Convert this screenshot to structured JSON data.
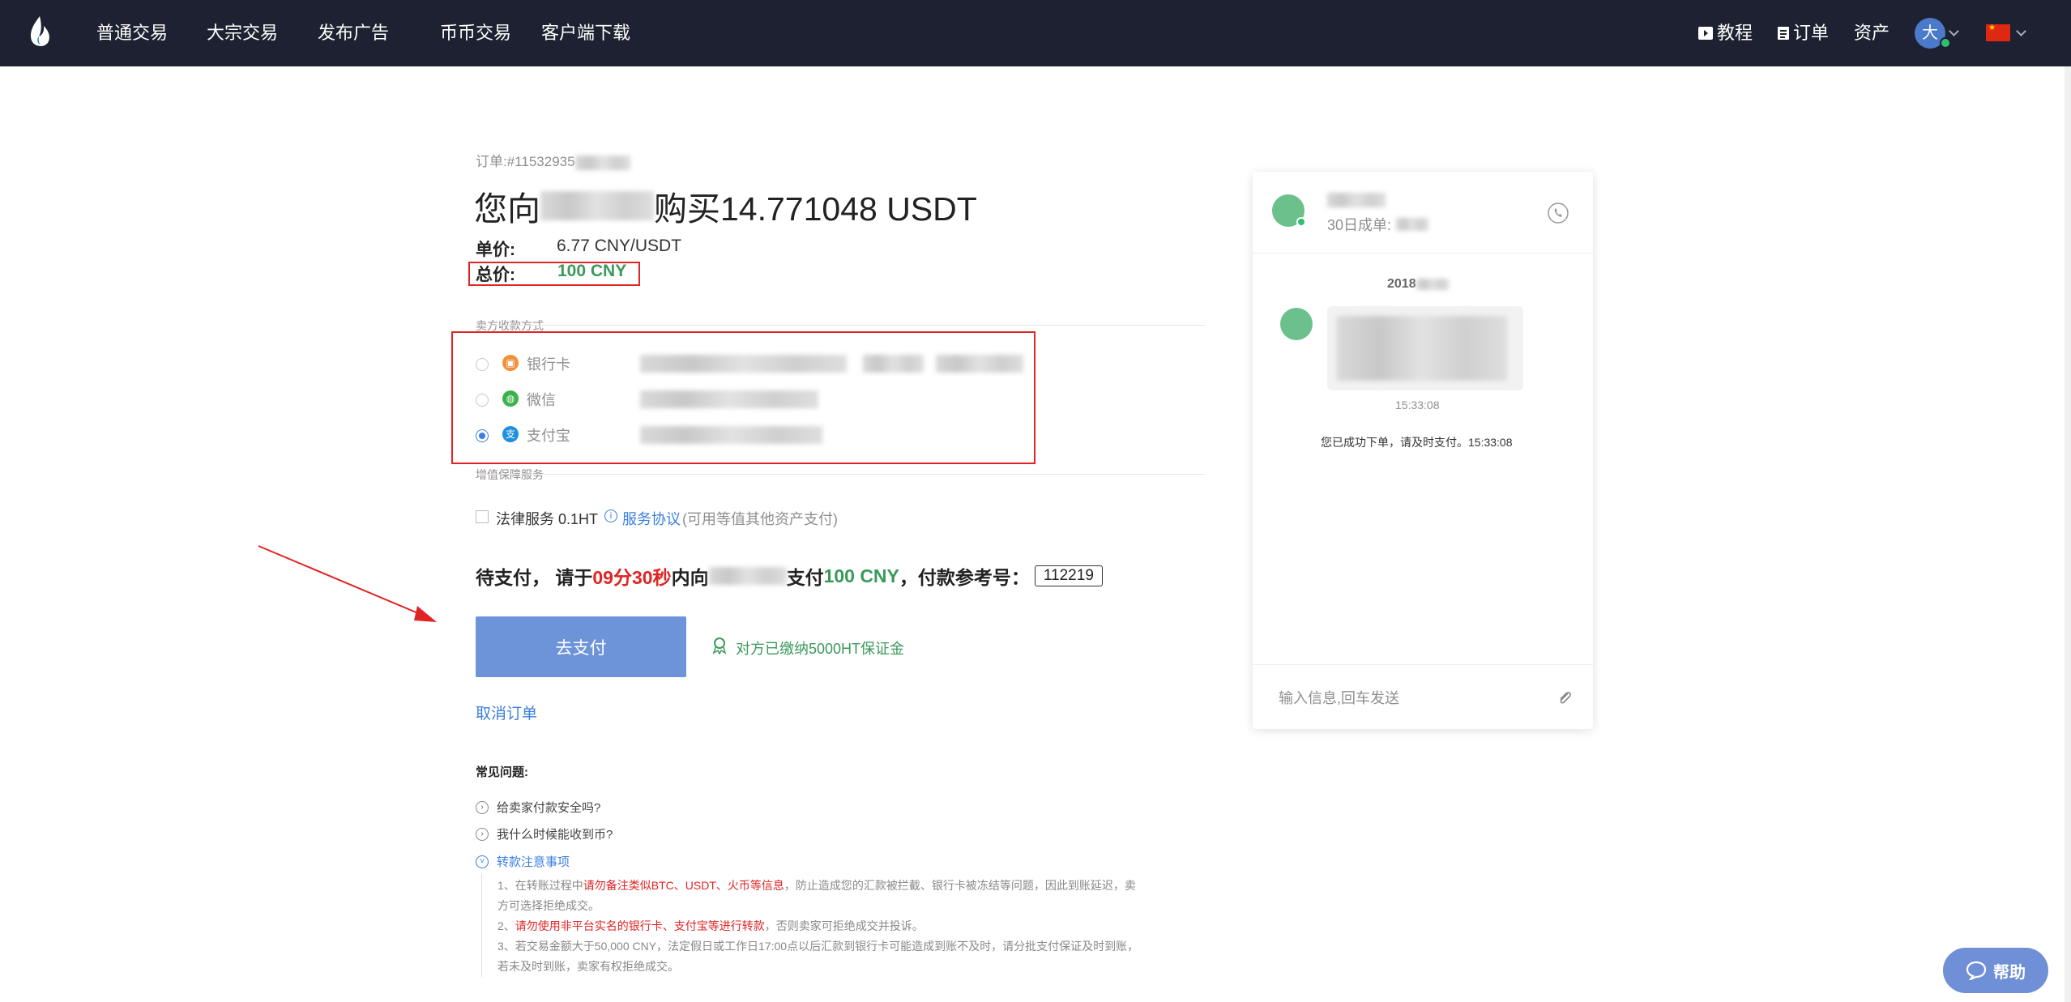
{
  "nav": {
    "items": [
      "普通交易",
      "大宗交易",
      "发布广告",
      "币币交易",
      "客户端下载"
    ],
    "tutorial": "教程",
    "orders": "订单",
    "assets": "资产",
    "avatar_text": "大"
  },
  "order": {
    "number_label": "订单:#11532935",
    "title_prefix": "您向",
    "title_suffix": "购买14.771048 USDT",
    "unit_price_label": "单价:",
    "unit_price": "6.77 CNY/USDT",
    "total_label": "总价:",
    "total": "100 CNY"
  },
  "payment": {
    "section_label": "卖方收款方式",
    "methods": [
      {
        "label": "银行卡",
        "icon": "bank-card-icon",
        "color": "#f0913a",
        "selected": false
      },
      {
        "label": "微信",
        "icon": "wechat-icon",
        "color": "#3cb34a",
        "selected": false
      },
      {
        "label": "支付宝",
        "icon": "alipay-icon",
        "color": "#1f8fe0",
        "selected": true
      }
    ]
  },
  "service": {
    "section_label": "增值保障服务",
    "legal_label": "法律服务 0.1HT",
    "agreement": "服务协议",
    "note": "(可用等值其他资产支付)"
  },
  "pending": {
    "prefix": "待支付，  请于",
    "countdown": "09分30秒",
    "mid": "内向",
    "pay": "支付",
    "amount": "100 CNY",
    "ref_label": "，付款参考号：",
    "ref": "112219"
  },
  "actions": {
    "pay_button": "去支付",
    "deposit_note": "对方已缴纳5000HT保证金",
    "cancel": "取消订单"
  },
  "faq": {
    "title": "常见问题:",
    "q1": "给卖家付款安全吗?",
    "q2": "我什么时候能收到币?",
    "q3": "转款注意事项",
    "l1a": "1、在转账过程中",
    "l1b": "请勿备注类似BTC、USDT、火币等信息",
    "l1c": "，防止造成您的汇款被拦截、银行卡被冻结等问题，因此到账延迟，卖",
    "l1d": "方可选择拒绝成交。",
    "l2a": "2、",
    "l2b": "请勿使用非平台实名的银行卡、支付宝等进行转款",
    "l2c": "，否则卖家可拒绝成交并投诉。",
    "l3a": "3、若交易金额大于50,000 CNY，法定假日或工作日17:00点以后汇款到银行卡可能造成到账不及时，请分批支付保证及时到账，",
    "l3b": "若未及时到账，卖家有权拒绝成交。"
  },
  "chat": {
    "orders_label": "30日成单:",
    "date": "2018",
    "msg_time": "15:33:08",
    "system_msg": "您已成功下单，请及时支付。15:33:08",
    "input_placeholder": "输入信息,回车发送"
  },
  "help": "帮助"
}
